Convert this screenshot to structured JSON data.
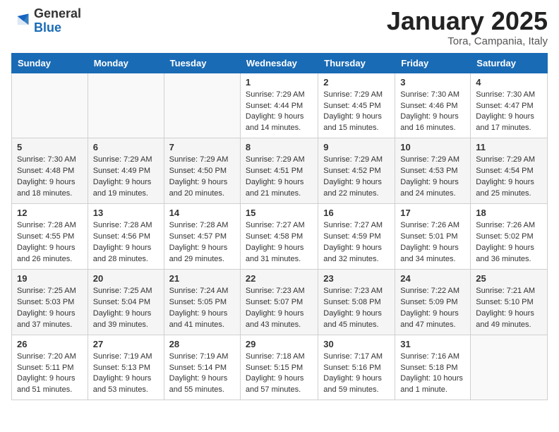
{
  "logo": {
    "general": "General",
    "blue": "Blue"
  },
  "header": {
    "month": "January 2025",
    "location": "Tora, Campania, Italy"
  },
  "weekdays": [
    "Sunday",
    "Monday",
    "Tuesday",
    "Wednesday",
    "Thursday",
    "Friday",
    "Saturday"
  ],
  "weeks": [
    [
      {
        "day": "",
        "info": ""
      },
      {
        "day": "",
        "info": ""
      },
      {
        "day": "",
        "info": ""
      },
      {
        "day": "1",
        "sunrise": "7:29 AM",
        "sunset": "4:44 PM",
        "daylight": "9 hours and 14 minutes."
      },
      {
        "day": "2",
        "sunrise": "7:29 AM",
        "sunset": "4:45 PM",
        "daylight": "9 hours and 15 minutes."
      },
      {
        "day": "3",
        "sunrise": "7:30 AM",
        "sunset": "4:46 PM",
        "daylight": "9 hours and 16 minutes."
      },
      {
        "day": "4",
        "sunrise": "7:30 AM",
        "sunset": "4:47 PM",
        "daylight": "9 hours and 17 minutes."
      }
    ],
    [
      {
        "day": "5",
        "sunrise": "7:30 AM",
        "sunset": "4:48 PM",
        "daylight": "9 hours and 18 minutes."
      },
      {
        "day": "6",
        "sunrise": "7:29 AM",
        "sunset": "4:49 PM",
        "daylight": "9 hours and 19 minutes."
      },
      {
        "day": "7",
        "sunrise": "7:29 AM",
        "sunset": "4:50 PM",
        "daylight": "9 hours and 20 minutes."
      },
      {
        "day": "8",
        "sunrise": "7:29 AM",
        "sunset": "4:51 PM",
        "daylight": "9 hours and 21 minutes."
      },
      {
        "day": "9",
        "sunrise": "7:29 AM",
        "sunset": "4:52 PM",
        "daylight": "9 hours and 22 minutes."
      },
      {
        "day": "10",
        "sunrise": "7:29 AM",
        "sunset": "4:53 PM",
        "daylight": "9 hours and 24 minutes."
      },
      {
        "day": "11",
        "sunrise": "7:29 AM",
        "sunset": "4:54 PM",
        "daylight": "9 hours and 25 minutes."
      }
    ],
    [
      {
        "day": "12",
        "sunrise": "7:28 AM",
        "sunset": "4:55 PM",
        "daylight": "9 hours and 26 minutes."
      },
      {
        "day": "13",
        "sunrise": "7:28 AM",
        "sunset": "4:56 PM",
        "daylight": "9 hours and 28 minutes."
      },
      {
        "day": "14",
        "sunrise": "7:28 AM",
        "sunset": "4:57 PM",
        "daylight": "9 hours and 29 minutes."
      },
      {
        "day": "15",
        "sunrise": "7:27 AM",
        "sunset": "4:58 PM",
        "daylight": "9 hours and 31 minutes."
      },
      {
        "day": "16",
        "sunrise": "7:27 AM",
        "sunset": "4:59 PM",
        "daylight": "9 hours and 32 minutes."
      },
      {
        "day": "17",
        "sunrise": "7:26 AM",
        "sunset": "5:01 PM",
        "daylight": "9 hours and 34 minutes."
      },
      {
        "day": "18",
        "sunrise": "7:26 AM",
        "sunset": "5:02 PM",
        "daylight": "9 hours and 36 minutes."
      }
    ],
    [
      {
        "day": "19",
        "sunrise": "7:25 AM",
        "sunset": "5:03 PM",
        "daylight": "9 hours and 37 minutes."
      },
      {
        "day": "20",
        "sunrise": "7:25 AM",
        "sunset": "5:04 PM",
        "daylight": "9 hours and 39 minutes."
      },
      {
        "day": "21",
        "sunrise": "7:24 AM",
        "sunset": "5:05 PM",
        "daylight": "9 hours and 41 minutes."
      },
      {
        "day": "22",
        "sunrise": "7:23 AM",
        "sunset": "5:07 PM",
        "daylight": "9 hours and 43 minutes."
      },
      {
        "day": "23",
        "sunrise": "7:23 AM",
        "sunset": "5:08 PM",
        "daylight": "9 hours and 45 minutes."
      },
      {
        "day": "24",
        "sunrise": "7:22 AM",
        "sunset": "5:09 PM",
        "daylight": "9 hours and 47 minutes."
      },
      {
        "day": "25",
        "sunrise": "7:21 AM",
        "sunset": "5:10 PM",
        "daylight": "9 hours and 49 minutes."
      }
    ],
    [
      {
        "day": "26",
        "sunrise": "7:20 AM",
        "sunset": "5:11 PM",
        "daylight": "9 hours and 51 minutes."
      },
      {
        "day": "27",
        "sunrise": "7:19 AM",
        "sunset": "5:13 PM",
        "daylight": "9 hours and 53 minutes."
      },
      {
        "day": "28",
        "sunrise": "7:19 AM",
        "sunset": "5:14 PM",
        "daylight": "9 hours and 55 minutes."
      },
      {
        "day": "29",
        "sunrise": "7:18 AM",
        "sunset": "5:15 PM",
        "daylight": "9 hours and 57 minutes."
      },
      {
        "day": "30",
        "sunrise": "7:17 AM",
        "sunset": "5:16 PM",
        "daylight": "9 hours and 59 minutes."
      },
      {
        "day": "31",
        "sunrise": "7:16 AM",
        "sunset": "5:18 PM",
        "daylight": "10 hours and 1 minute."
      },
      {
        "day": "",
        "info": ""
      }
    ]
  ],
  "labels": {
    "sunrise": "Sunrise:",
    "sunset": "Sunset:",
    "daylight": "Daylight hours"
  }
}
